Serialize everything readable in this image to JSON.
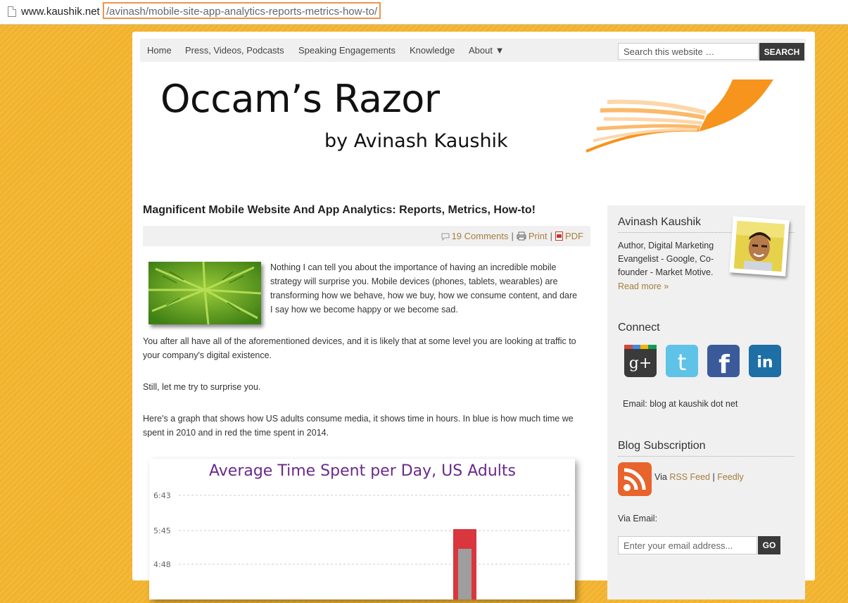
{
  "browser": {
    "url_host": "www.kaushik.net",
    "url_path": "/avinash/mobile-site-app-analytics-reports-metrics-how-to/"
  },
  "nav": {
    "items": [
      {
        "label": "Home"
      },
      {
        "label": "Press, Videos, Podcasts"
      },
      {
        "label": "Speaking Engagements"
      },
      {
        "label": "Knowledge"
      },
      {
        "label": "About ▼"
      }
    ],
    "search_placeholder": "Search this website …",
    "search_button": "SEARCH"
  },
  "header": {
    "title": "Occam’s Razor",
    "subtitle": "by Avinash Kaushik",
    "logo_colors": [
      "#f7941d",
      "#fbb96b",
      "#fcd7a9"
    ]
  },
  "article": {
    "title": "Magnificent Mobile Website And App Analytics: Reports, Metrics, How-to!",
    "comments": "19 Comments",
    "print": "Print",
    "pdf": "PDF",
    "paragraphs": [
      "Nothing I can tell you about the importance of having an incredible mobile strategy will surprise you. Mobile devices (phones, tablets, wearables) are transforming how we behave, how we buy, how we consume content, and dare I say how we become happy or we become sad.",
      "You after all have all of the aforementioned devices, and it is likely that at some level you are looking at traffic to your company's digital existence.",
      "Still, let me try to surprise you.",
      "Here's a graph that shows how US adults consume media, it shows time in hours. In blue is how much time we spent in 2010 and in red the time spent in 2014."
    ]
  },
  "chart_data": {
    "type": "bar",
    "title": "Average Time Spent per Day, US Adults",
    "y_ticks": [
      "6:43",
      "5:45",
      "4:48"
    ],
    "bar_colors": [
      "#d9363e",
      "#9e9e9e"
    ],
    "title_color": "#6a2a8a"
  },
  "sidebar": {
    "author": {
      "name": "Avinash Kaushik",
      "bio": "Author, Digital Marketing Evangelist - Google, Co-founder - Market Motive.",
      "read_more": "Read more »"
    },
    "connect": {
      "heading": "Connect",
      "networks": [
        {
          "icon": "google-plus-icon",
          "glyph": "g+"
        },
        {
          "icon": "twitter-icon",
          "glyph": "t"
        },
        {
          "icon": "facebook-icon",
          "glyph": "f"
        },
        {
          "icon": "linkedin-icon",
          "glyph": "in"
        }
      ],
      "email_text": "Email: blog at kaushik dot net"
    },
    "subscription": {
      "heading": "Blog Subscription",
      "via": "Via",
      "rss": "RSS Feed",
      "separator": "|",
      "feedly": "Feedly",
      "via_email": "Via Email:",
      "email_placeholder": "Enter your email address...",
      "go": "GO"
    }
  }
}
